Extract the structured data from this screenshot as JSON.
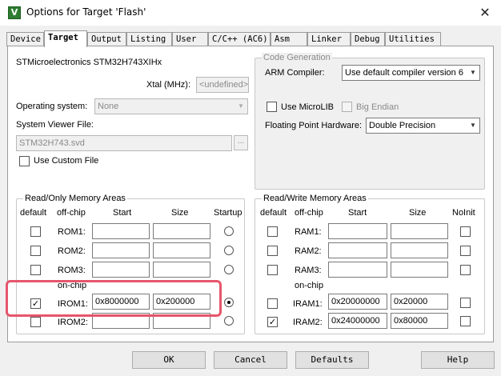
{
  "window": {
    "title": "Options for Target 'Flash'",
    "icon": "keil-app-icon",
    "close_glyph": "✕"
  },
  "tabs": [
    {
      "label": "Device"
    },
    {
      "label": "Target"
    },
    {
      "label": "Output"
    },
    {
      "label": "Listing"
    },
    {
      "label": "User"
    },
    {
      "label": "C/C++ (AC6)"
    },
    {
      "label": "Asm"
    },
    {
      "label": "Linker"
    },
    {
      "label": "Debug"
    },
    {
      "label": "Utilities"
    }
  ],
  "active_tab": "Target",
  "device_name": "STMicroelectronics STM32H743XIHx",
  "xtal": {
    "label": "Xtal (MHz):",
    "value": "<undefined>"
  },
  "operating_system": {
    "label": "Operating system:",
    "value": "None"
  },
  "svd": {
    "label": "System Viewer File:",
    "value": "STM32H743.svd",
    "browse": "..."
  },
  "use_custom_file": {
    "label": "Use Custom File",
    "checked": false
  },
  "code_gen": {
    "title": "Code Generation",
    "arm_compiler_label": "ARM Compiler:",
    "arm_compiler_value": "Use default compiler version 6",
    "microlib_label": "Use MicroLIB",
    "microlib_checked": false,
    "big_endian_label": "Big Endian",
    "big_endian_checked": false,
    "fpu_label": "Floating Point Hardware:",
    "fpu_value": "Double Precision"
  },
  "rom": {
    "title": "Read/Only Memory Areas",
    "headers": {
      "default": "default",
      "offchip": "off-chip",
      "start": "Start",
      "size": "Size",
      "startup": "Startup"
    },
    "onchip_label": "on-chip",
    "rows": [
      {
        "name": "ROM1:",
        "default": false,
        "start": "",
        "size": "",
        "startup": false
      },
      {
        "name": "ROM2:",
        "default": false,
        "start": "",
        "size": "",
        "startup": false
      },
      {
        "name": "ROM3:",
        "default": false,
        "start": "",
        "size": "",
        "startup": false
      },
      {
        "name": "IROM1:",
        "default": true,
        "start": "0x8000000",
        "size": "0x200000",
        "startup": true
      },
      {
        "name": "IROM2:",
        "default": false,
        "start": "",
        "size": "",
        "startup": false
      }
    ]
  },
  "ram": {
    "title": "Read/Write Memory Areas",
    "headers": {
      "default": "default",
      "offchip": "off-chip",
      "start": "Start",
      "size": "Size",
      "noinit": "NoInit"
    },
    "onchip_label": "on-chip",
    "rows": [
      {
        "name": "RAM1:",
        "default": false,
        "start": "",
        "size": "",
        "noinit": false
      },
      {
        "name": "RAM2:",
        "default": false,
        "start": "",
        "size": "",
        "noinit": false
      },
      {
        "name": "RAM3:",
        "default": false,
        "start": "",
        "size": "",
        "noinit": false
      },
      {
        "name": "IRAM1:",
        "default": false,
        "start": "0x20000000",
        "size": "0x20000",
        "noinit": false
      },
      {
        "name": "IRAM2:",
        "default": true,
        "start": "0x24000000",
        "size": "0x80000",
        "noinit": false
      }
    ]
  },
  "buttons": {
    "ok": "OK",
    "cancel": "Cancel",
    "defaults": "Defaults",
    "help": "Help"
  },
  "check_glyph": "✓",
  "annotation_color": "#e5566b"
}
